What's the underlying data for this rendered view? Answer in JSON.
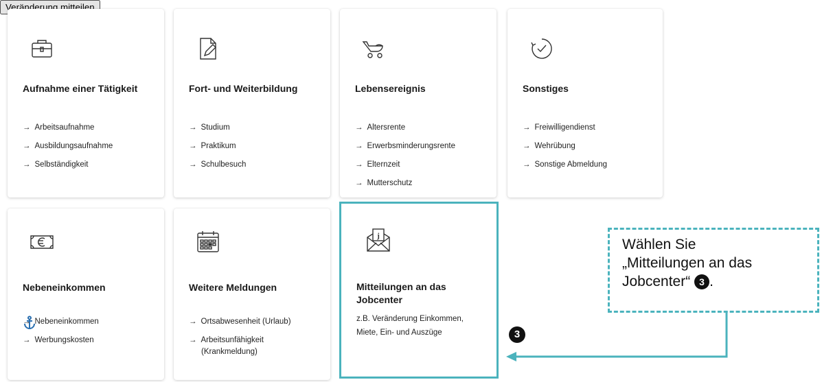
{
  "cards": [
    {
      "title": "Aufnahme einer Tätigkeit",
      "items": [
        "Arbeitsaufnahme",
        "Ausbildungsaufnahme",
        "Selbständigkeit"
      ]
    },
    {
      "title": "Fort- und Weiterbildung",
      "items": [
        "Studium",
        "Praktikum",
        "Schulbesuch"
      ]
    },
    {
      "title": "Lebensereignis",
      "items": [
        "Altersrente",
        "Erwerbsminderungsrente",
        "Elternzeit",
        "Mutterschutz"
      ]
    },
    {
      "title": "Sonstiges",
      "items": [
        "Freiwilligendienst",
        "Wehrübung",
        "Sonstige Abmeldung"
      ]
    },
    {
      "title": "Nebeneinkommen",
      "items": [
        "Nebeneinkommen",
        "Werbungskosten"
      ]
    },
    {
      "title": "Weitere Meldungen",
      "items": [
        "Ortsabwesenheit (Urlaub)",
        "Arbeitsunfähigkeit",
        "(Krankmeldung)"
      ]
    },
    {
      "title": "Mitteilungen an das Jobcenter",
      "description": "z.B. Veränderung Einkommen, Miete, Ein- und Auszüge",
      "button_label": "Veränderung mitteilen"
    }
  ],
  "arrow_glyph": "→",
  "icons": [
    "briefcase-icon",
    "document-edit-icon",
    "stroller-icon",
    "clock-check-icon",
    "euro-banknote-icon",
    "calendar-icon",
    "envelope-letter-icon"
  ],
  "callout": {
    "line1": "Wählen Sie",
    "line2": "„Mitteilungen an das",
    "line3": "Jobcenter“",
    "badge": "3",
    "suffix": "."
  },
  "step_badge": "3",
  "colors": {
    "accent": "#4bb3bd",
    "button": "#b5192a",
    "anchor": "#2a6fb0"
  }
}
